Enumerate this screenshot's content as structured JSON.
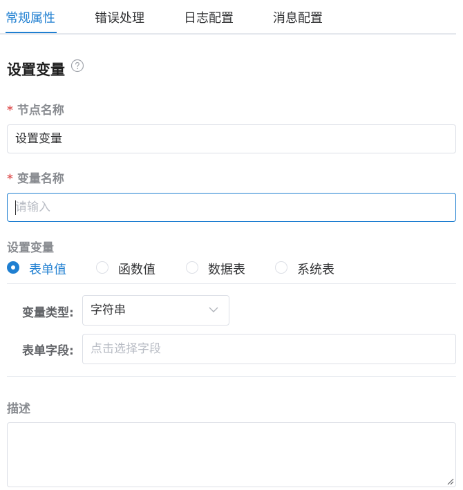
{
  "tabs": [
    {
      "label": "常规属性",
      "active": true
    },
    {
      "label": "错误处理",
      "active": false
    },
    {
      "label": "日志配置",
      "active": false
    },
    {
      "label": "消息配置",
      "active": false
    }
  ],
  "section": {
    "title": "设置变量",
    "help_icon": "question-circle-icon"
  },
  "node_name": {
    "required_mark": "*",
    "label": "节点名称",
    "value": "设置变量"
  },
  "var_name": {
    "required_mark": "*",
    "label": "变量名称",
    "placeholder": "请输入",
    "value": ""
  },
  "set_var": {
    "label": "设置变量",
    "options": [
      {
        "label": "表单值",
        "checked": true
      },
      {
        "label": "函数值",
        "checked": false
      },
      {
        "label": "数据表",
        "checked": false
      },
      {
        "label": "系统表",
        "checked": false
      }
    ]
  },
  "var_type": {
    "label": "变量类型:",
    "value": "字符串",
    "icon": "chevron-down-icon"
  },
  "form_field": {
    "label": "表单字段:",
    "placeholder": "点击选择字段"
  },
  "description": {
    "label": "描述",
    "value": ""
  },
  "colors": {
    "accent": "#1f7fd1",
    "required": "#e05a5a",
    "border": "#dcdfe6",
    "placeholder": "#b8bcc4"
  }
}
